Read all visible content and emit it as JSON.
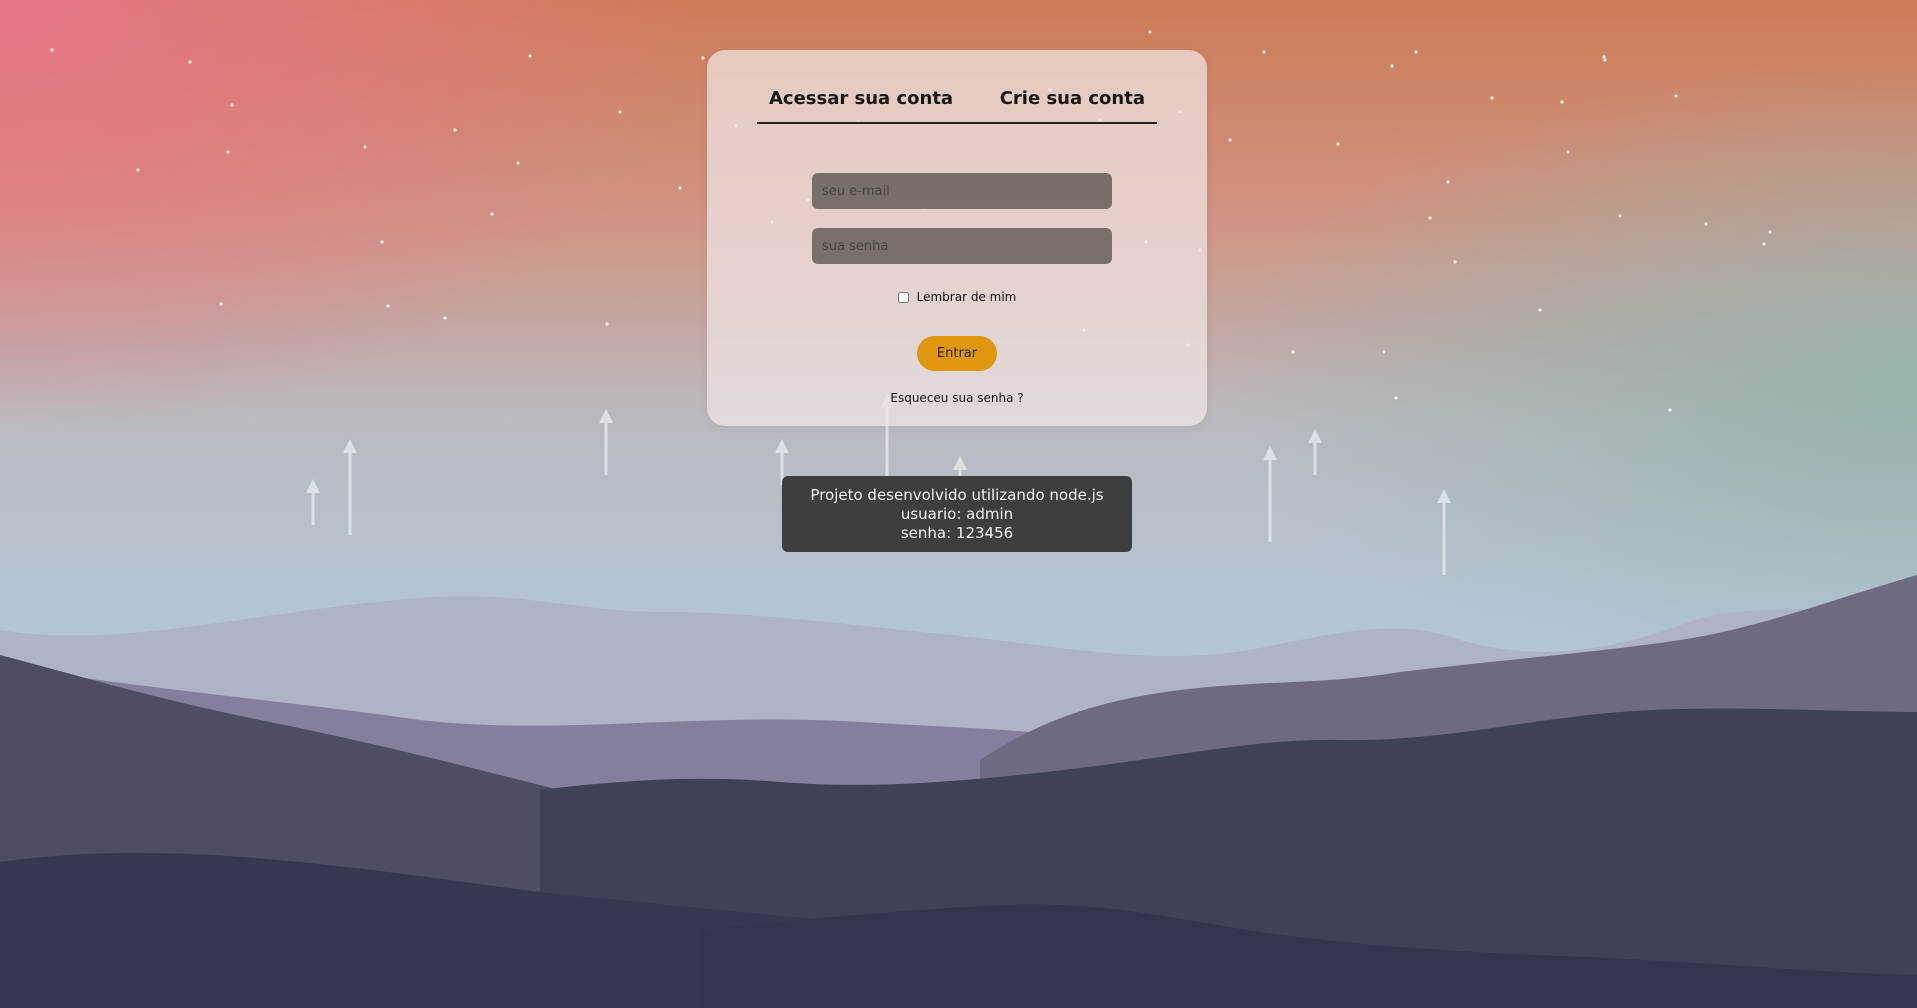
{
  "tabs": {
    "login": "Acessar sua conta",
    "signup": "Crie sua conta"
  },
  "form": {
    "email_placeholder": "seu e-mail",
    "password_placeholder": "sua senha",
    "remember_label": "Lembrar de mim",
    "remember_checked": false,
    "submit_label": "Entrar",
    "forgot_label": "Esqueceu sua senha ?"
  },
  "info": {
    "line1": "Projeto desenvolvido utilizando node.js",
    "line2": "usuario: admin",
    "line3": "senha: 123456"
  },
  "colors": {
    "accent": "#e1960f",
    "sky_top_left": "#e47483",
    "sky_top_right": "#c9794e",
    "sky_bottom": "#b5c7d6",
    "info_bg": "#3c3e40"
  }
}
